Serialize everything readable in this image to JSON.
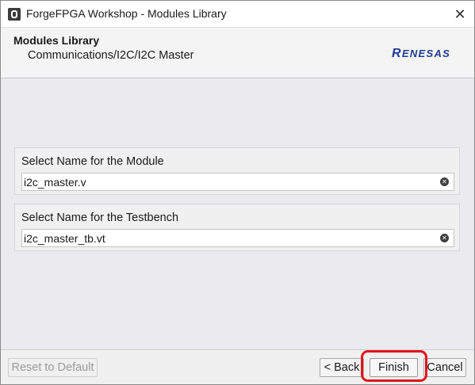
{
  "window": {
    "title": "ForgeFPGA Workshop - Modules Library",
    "close_glyph": "✕"
  },
  "header": {
    "title": "Modules Library",
    "breadcrumb": "Communications/I2C/I2C Master",
    "logo_text": "RENESAS",
    "logo_color": "#1f3c91"
  },
  "module_group": {
    "label": "Select Name for the Module",
    "value": "i2c_master.v",
    "clear_icon": "clear-icon"
  },
  "testbench_group": {
    "label": "Select Name for the Testbench",
    "value": "i2c_master_tb.vt",
    "clear_icon": "clear-icon"
  },
  "footer": {
    "reset_label": "Reset to Default",
    "back_label": "< Back",
    "finish_label": "Finish",
    "cancel_label": "Cancel"
  },
  "annotation": {
    "highlight_color": "#e1141a",
    "highlighted": "finish-button"
  }
}
